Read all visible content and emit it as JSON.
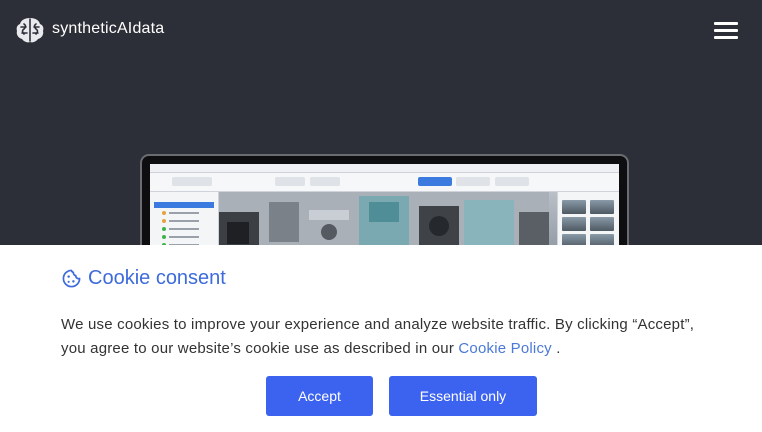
{
  "header": {
    "brand_name": "syntheticAIdata",
    "logo_icon": "brain-icon",
    "menu_icon": "hamburger-menu-icon"
  },
  "hero": {
    "image": "laptop-screenshot-3d-scene-editor"
  },
  "cookie": {
    "title": "Cookie consent",
    "title_icon": "cookie-icon",
    "text_before_link": "We use cookies to improve your experience and analyze website traffic. By clicking “Accept”, you agree to our website’s cookie use as described in our ",
    "link_text": "Cookie Policy",
    "text_after_link": " .",
    "accept_label": "Accept",
    "essential_label": "Essential only",
    "accent_color": "#3c63f0",
    "title_color": "#3d6bdb"
  }
}
